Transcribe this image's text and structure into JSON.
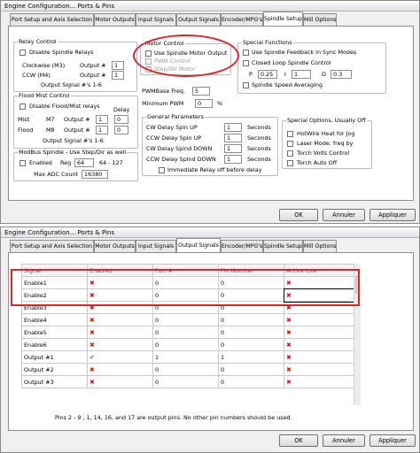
{
  "top_window": {
    "title": "Engine Configuration... Ports & Pins",
    "tabs": [
      "Port Setup and Axis Selection",
      "Motor Outputs",
      "Input Signals",
      "Output Signals",
      "Encoder/MPG's",
      "Spindle Setup",
      "Mill Options"
    ],
    "active_tab": "Spindle Setup",
    "relay_control": {
      "title": "Relay Control",
      "disable_label": "Disable Spindle Relays",
      "clockwise_label": "Clockwise (M3)",
      "ccw_label": "CCW (M4)",
      "output_label": "Output #",
      "clockwise_value": "1",
      "ccw_value": "1",
      "signals_note": "Output Signal #'s 1-6"
    },
    "motor_control": {
      "title": "Motor Control",
      "use_motor_output": "Use Spindle Motor Output",
      "pwm_control": "PWM Control",
      "step_dir_motor": "Step/Dir Motor"
    },
    "special_functions": {
      "title": "Special Functions",
      "feedback_sync": "Use Spindle Feedback in Sync Modes",
      "closed_loop": "Closed Loop Spindle Control",
      "p_label": "P",
      "p_value": "0.25",
      "i_label": "I",
      "i_value": "1",
      "d_label": "D",
      "d_value": "0.3",
      "speed_averaging": "Spindle Speed Averaging"
    },
    "flood_mist": {
      "title": "Flood Mist Control",
      "disable_label": "Disable Flood/Mist relays",
      "delay_label": "Delay",
      "mist_label": "Mist",
      "mist_code": "M7",
      "flood_label": "Flood",
      "flood_code": "M8",
      "output_label": "Output #",
      "mist_output": "1",
      "mist_delay": "0",
      "flood_output": "1",
      "flood_delay": "0",
      "signals_note": "Output Signal #'s 1-6"
    },
    "modbus": {
      "title": "ModBus Spindle - Use Step/Dir as well",
      "enabled_label": "Enabled",
      "reg_label": "Reg",
      "reg_value": "64",
      "reg_range": "64 - 127",
      "max_adc_label": "Max ADC Count",
      "max_adc_value": "16380"
    },
    "pwm": {
      "base_freq_label": "PWMBase Freq.",
      "base_freq_value": "5",
      "min_pwm_label": "Minimum PWM",
      "min_pwm_value": "0",
      "min_pwm_unit": "%"
    },
    "general": {
      "title": "General Parameters",
      "rows": [
        {
          "label": "CW Delay Spin UP",
          "value": "1",
          "unit": "Seconds"
        },
        {
          "label": "CCW Delay Spin UP",
          "value": "1",
          "unit": "Seconds"
        },
        {
          "label": "CW Delay Spind DOWN",
          "value": "1",
          "unit": "Seconds"
        },
        {
          "label": "CCW Delay Spind DOWN",
          "value": "1",
          "unit": "Seconds"
        }
      ],
      "immediate_relay": "Immediate Relay off before delay"
    },
    "special_options": {
      "title": "Special Options, Usually Off",
      "items": [
        "HotWire Heat for Jog",
        "Laser Mode. freq by",
        "Torch Volts Control",
        "Torch Auto Off"
      ]
    },
    "buttons": {
      "ok": "OK",
      "cancel": "Annuler",
      "apply": "Appliquer"
    }
  },
  "bottom_window": {
    "title": "Engine Configuration... Ports & Pins",
    "tabs": [
      "Port Setup and Axis Selection",
      "Motor Outputs",
      "Input Signals",
      "Output Signals",
      "Encoder/MPG's",
      "Spindle Setup",
      "Mill Options"
    ],
    "active_tab": "Output Signals",
    "table": {
      "headers": [
        "Signal",
        "Enabled",
        "Port #",
        "Pin Number",
        "Active Low"
      ],
      "rows": [
        {
          "signal": "Enable1",
          "enabled": "x",
          "port": "0",
          "pin": "0",
          "active_low": "x"
        },
        {
          "signal": "Enable2",
          "enabled": "x",
          "port": "0",
          "pin": "0",
          "active_low": "x"
        },
        {
          "signal": "Enable3",
          "enabled": "x",
          "port": "0",
          "pin": "0",
          "active_low": "x"
        },
        {
          "signal": "Enable4",
          "enabled": "x",
          "port": "0",
          "pin": "0",
          "active_low": "x"
        },
        {
          "signal": "Enable5",
          "enabled": "x",
          "port": "0",
          "pin": "0",
          "active_low": "x"
        },
        {
          "signal": "Enable6",
          "enabled": "x",
          "port": "0",
          "pin": "0",
          "active_low": "x"
        },
        {
          "signal": "Output #1",
          "enabled": "check",
          "port": "1",
          "pin": "1",
          "active_low": "x"
        },
        {
          "signal": "Output #2",
          "enabled": "x",
          "port": "0",
          "pin": "0",
          "active_low": "x"
        },
        {
          "signal": "Output #3",
          "enabled": "x",
          "port": "0",
          "pin": "0",
          "active_low": "x"
        }
      ]
    },
    "note": "Pins 2 - 9 , 1, 14, 16, and 17 are output pins. No  other pin numbers should be used.",
    "buttons": {
      "ok": "OK",
      "cancel": "Annuler",
      "apply": "Appliquer"
    }
  },
  "annotation_color": "#e0242b",
  "icons": {
    "disabled": "red-x-icon",
    "enabled": "green-check-icon"
  }
}
